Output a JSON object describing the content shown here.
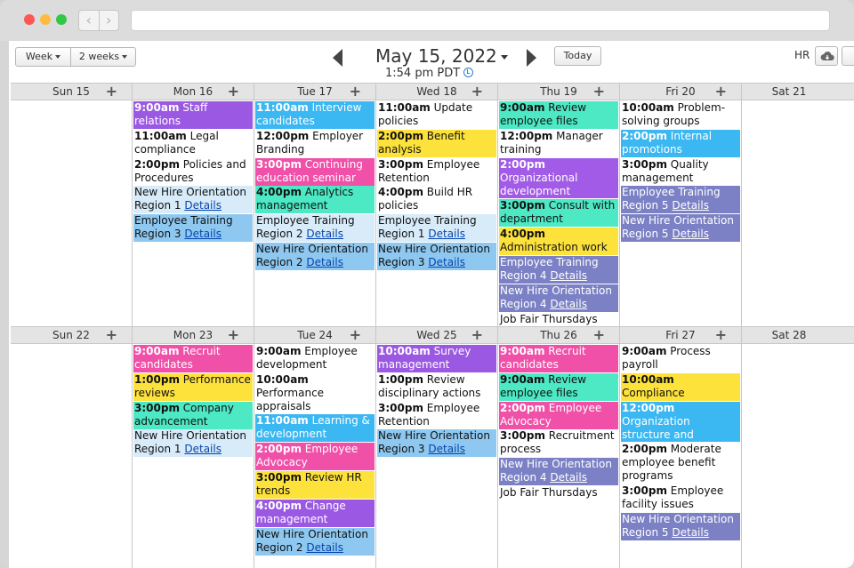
{
  "toolbar": {
    "week_label": "Week",
    "two_weeks_label": "2 weeks",
    "date_title": "May 15, 2022",
    "time_label": "1:54 pm PDT",
    "today_label": "Today",
    "calendar_name": "HR"
  },
  "weeks": [
    {
      "days": [
        {
          "name": "Sun 15"
        },
        {
          "name": "Mon 16"
        },
        {
          "name": "Tue 17"
        },
        {
          "name": "Wed 18"
        },
        {
          "name": "Thu 19"
        },
        {
          "name": "Fri 20"
        },
        {
          "name": "Sat 21"
        }
      ]
    },
    {
      "days": [
        {
          "name": "Sun 22"
        },
        {
          "name": "Mon 23"
        },
        {
          "name": "Tue 24"
        },
        {
          "name": "Wed 25"
        },
        {
          "name": "Thu 26"
        },
        {
          "name": "Fri 27"
        },
        {
          "name": "Sat 28"
        }
      ]
    }
  ],
  "events": {
    "w1": {
      "mon": [
        {
          "time": "9:00am",
          "title": "Staff relations"
        },
        {
          "time": "11:00am",
          "title": "Legal compliance"
        },
        {
          "time": "2:00pm",
          "title": "Policies and Procedures"
        },
        {
          "title": "New Hire Orientation Region 1",
          "link": "Details"
        },
        {
          "title": "Employee Training Region 3",
          "link": "Details"
        }
      ],
      "tue": [
        {
          "time": "11:00am",
          "title": "Interview candidates"
        },
        {
          "time": "12:00pm",
          "title": "Employer Branding"
        },
        {
          "time": "3:00pm",
          "title": "Continuing education seminar"
        },
        {
          "time": "4:00pm",
          "title": "Analytics management"
        },
        {
          "title": "Employee Training Region 2",
          "link": "Details"
        },
        {
          "title": "New Hire Orientation Region 2",
          "link": "Details"
        }
      ],
      "wed": [
        {
          "time": "11:00am",
          "title": "Update policies"
        },
        {
          "time": "2:00pm",
          "title": "Benefit analysis"
        },
        {
          "time": "3:00pm",
          "title": "Employee Retention"
        },
        {
          "time": "4:00pm",
          "title": "Build HR policies"
        },
        {
          "title": "Employee Training Region 1",
          "link": "Details"
        },
        {
          "title": "New Hire Orientation Region 3",
          "link": "Details"
        }
      ],
      "thu": [
        {
          "time": "9:00am",
          "title": "Review employee files"
        },
        {
          "time": "12:00pm",
          "title": "Manager training"
        },
        {
          "time": "2:00pm",
          "title": "Organizational development"
        },
        {
          "time": "3:00pm",
          "title": "Consult with department managers"
        },
        {
          "time": "4:00pm",
          "title": "Administration work"
        },
        {
          "title": "Employee Training Region 4",
          "link": "Details"
        },
        {
          "title": "New Hire Orientation Region 4",
          "link": "Details"
        },
        {
          "title": "Job Fair Thursdays"
        }
      ],
      "fri": [
        {
          "time": "10:00am",
          "title": "Problem-solving groups"
        },
        {
          "time": "2:00pm",
          "title": "Internal promotions"
        },
        {
          "time": "3:00pm",
          "title": "Quality management"
        },
        {
          "title": "Employee Training Region 5",
          "link": "Details"
        },
        {
          "title": "New Hire Orientation Region 5",
          "link": "Details"
        }
      ]
    },
    "w2": {
      "mon": [
        {
          "time": "9:00am",
          "title": "Recruit candidates"
        },
        {
          "time": "1:00pm",
          "title": "Performance reviews"
        },
        {
          "time": "3:00pm",
          "title": "Company advancement seminar"
        },
        {
          "title": "New Hire Orientation Region 1",
          "link": "Details"
        }
      ],
      "tue": [
        {
          "time": "9:00am",
          "title": "Employee development program"
        },
        {
          "time": "10:00am",
          "title": "Performance appraisals"
        },
        {
          "time": "11:00am",
          "title": "Learning & development"
        },
        {
          "time": "2:00pm",
          "title": "Employee Advocacy"
        },
        {
          "time": "3:00pm",
          "title": "Review HR trends"
        },
        {
          "time": "4:00pm",
          "title": "Change management"
        },
        {
          "title": "New Hire Orientation Region 2",
          "link": "Details"
        }
      ],
      "wed": [
        {
          "time": "10:00am",
          "title": "Survey management"
        },
        {
          "time": "1:00pm",
          "title": "Review disciplinary actions"
        },
        {
          "time": "3:00pm",
          "title": "Employee Retention"
        },
        {
          "title": "New Hire Orientation Region 3",
          "link": "Details"
        }
      ],
      "thu": [
        {
          "time": "9:00am",
          "title": "Recruit candidates"
        },
        {
          "time": "9:00am",
          "title": "Review employee files"
        },
        {
          "time": "2:00pm",
          "title": "Employee Advocacy"
        },
        {
          "time": "3:00pm",
          "title": "Recruitment process"
        },
        {
          "title": "New Hire Orientation Region 4",
          "link": "Details"
        },
        {
          "title": "Job Fair Thursdays"
        }
      ],
      "fri": [
        {
          "time": "9:00am",
          "title": "Process payroll"
        },
        {
          "time": "10:00am",
          "title": "Compliance management"
        },
        {
          "time": "12:00pm",
          "title": "Organization structure and planning"
        },
        {
          "time": "2:00pm",
          "title": "Moderate employee benefit programs"
        },
        {
          "time": "3:00pm",
          "title": "Employee facility issues"
        },
        {
          "title": "New Hire Orientation Region 5",
          "link": "Details"
        }
      ]
    }
  },
  "colors": {
    "purple": "#9b59e3",
    "cyan": "#3bb7f2",
    "teal": "#4de8c4",
    "yellow": "#fde23c",
    "pink": "#f050a8",
    "light_blue": "#d7ebf9",
    "blue": "#8ec8f0",
    "slate": "#7b81c4"
  }
}
